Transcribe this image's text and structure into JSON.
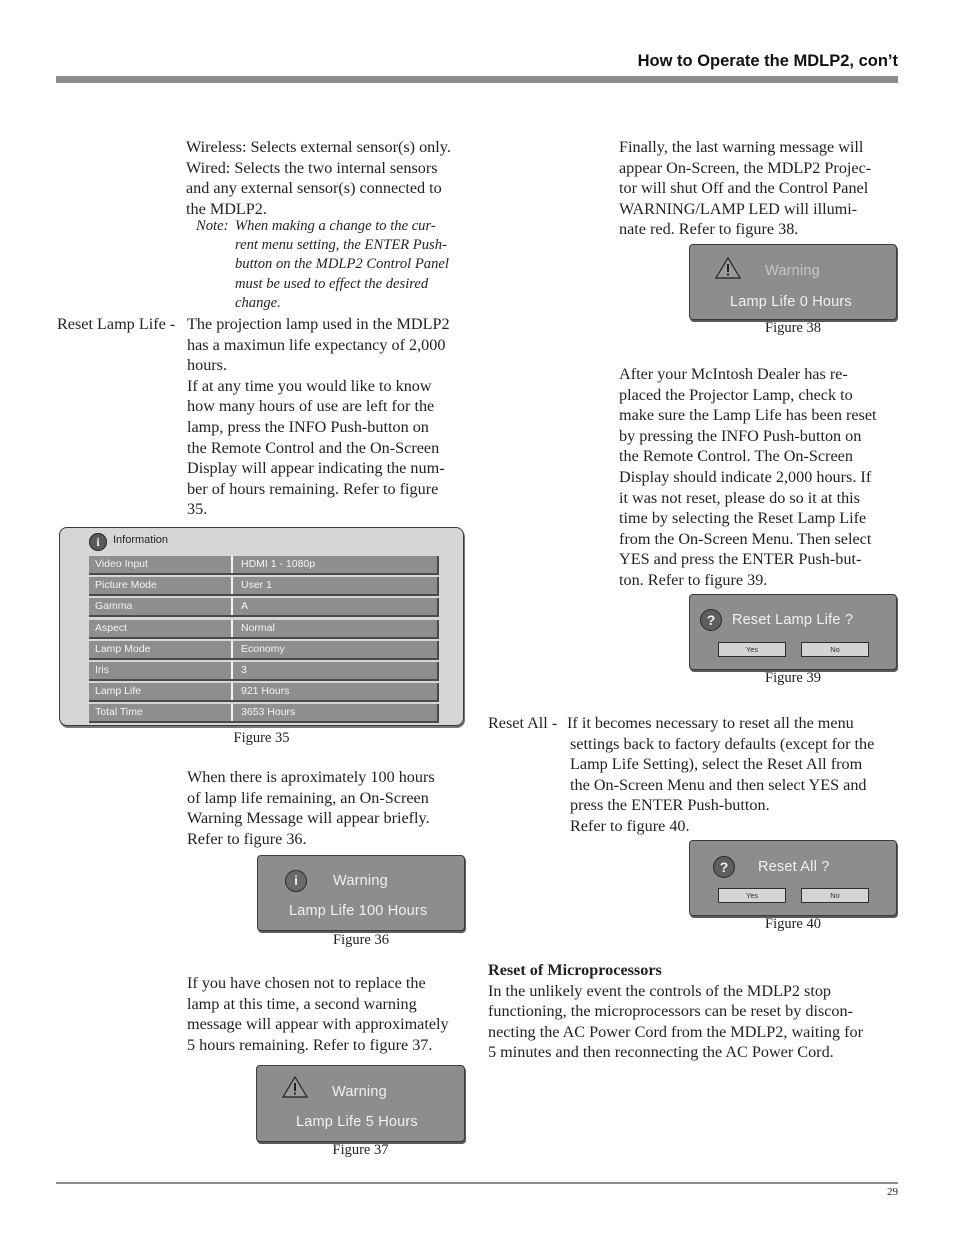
{
  "header": {
    "title": "How to Operate the MDLP2, con’t"
  },
  "left_column": {
    "intro_lines": [
      "Wireless: Selects external sensor(s) only.",
      "Wired: Selects the two internal sensors",
      "and any external sensor(s) connected to",
      "the MDLP2."
    ],
    "note": {
      "label": "Note:",
      "lines": [
        "When making a change to the cur-",
        "rent menu setting, the ENTER Push-",
        "button on the MDLP2 Control Panel",
        "must be used to effect the desired",
        "change."
      ]
    },
    "reset_lamp_life": {
      "term": "Reset Lamp Life -",
      "lines": [
        "The projection lamp used in the MDLP2",
        "has a maximun life expectancy of 2,000",
        "hours.",
        "If at any time you would like to know",
        "how many hours of use are left for the",
        "lamp, press the INFO Push-button on",
        "the Remote Control and the On-Screen",
        "Display will appear indicating the num-",
        "ber of hours remaining. Refer to figure",
        "35."
      ]
    },
    "figure35": {
      "title": "Information",
      "icon": "info-icon",
      "rows": [
        {
          "label": "Video Input",
          "value": "HDMI 1 - 1080p"
        },
        {
          "label": "Picture Mode",
          "value": "User 1"
        },
        {
          "label": "Gamma",
          "value": "A"
        },
        {
          "label": "Aspect",
          "value": "Normal"
        },
        {
          "label": "Lamp Mode",
          "value": "Economy"
        },
        {
          "label": "Iris",
          "value": "3"
        },
        {
          "label": "Lamp Life",
          "value": "921 Hours"
        },
        {
          "label": "Total Time",
          "value": "3653 Hours"
        }
      ],
      "caption": "Figure 35"
    },
    "para_100": [
      "When there is aproximately 100 hours",
      "of lamp life remaining, an On-Screen",
      "Warning Message will appear briefly.",
      "Refer to figure 36."
    ],
    "figure36": {
      "icon": "info-icon",
      "title": "Warning",
      "message": "Lamp Life 100 Hours",
      "caption": "Figure 36"
    },
    "para_5": [
      "If you have chosen not to replace the",
      "lamp at this time, a second warning",
      "message will appear with approximately",
      "5 hours remaining. Refer to figure 37."
    ],
    "figure37": {
      "icon": "warning-triangle-icon",
      "title": "Warning",
      "message": "Lamp Life 5 Hours",
      "caption": "Figure 37"
    }
  },
  "right_column": {
    "para_final": [
      "Finally, the last warning message will",
      "appear On-Screen, the MDLP2 Projec-",
      "tor will shut Off and the Control Panel",
      "WARNING/LAMP LED will illumi-",
      "nate red. Refer to figure 38."
    ],
    "figure38": {
      "icon": "warning-triangle-icon",
      "title": "Warning",
      "message": "Lamp Life 0 Hours",
      "caption": "Figure 38"
    },
    "para_after": [
      "After your McIntosh Dealer has re-",
      "placed the Projector Lamp, check to",
      "make sure the Lamp Life has been reset",
      "by pressing the INFO Push-button on",
      "the Remote Control. The On-Screen",
      "Display should indicate 2,000 hours. If",
      "it was not reset, please do so it at this",
      "time by selecting the Reset Lamp Life",
      "from the On-Screen Menu. Then select",
      "YES and press the ENTER Push-but-",
      "ton. Refer to figure 39."
    ],
    "figure39": {
      "icon": "question-icon",
      "title": "Reset Lamp Life ?",
      "yes": "Yes",
      "no": "No",
      "caption": "Figure 39"
    },
    "reset_all": {
      "term": "Reset All -",
      "first": "If it becomes necessary to reset all the menu",
      "lines": [
        "settings back to factory defaults (except for the",
        "Lamp Life Setting), select the Reset All from",
        "the On-Screen Menu and then select YES and",
        "press the ENTER Push-button.",
        "Refer to figure 40."
      ]
    },
    "figure40": {
      "icon": "question-icon",
      "title": "Reset All ?",
      "yes": "Yes",
      "no": "No",
      "caption": "Figure 40"
    },
    "micro": {
      "heading": "Reset of Microprocessors",
      "lines": [
        "In the unlikely event the controls of the MDLP2 stop",
        "functioning, the microprocessors can be reset by discon-",
        "necting the AC Power Cord from the MDLP2, waiting for",
        "5 minutes and then reconnecting the AC Power Cord."
      ]
    }
  },
  "footer": {
    "page_number": "29"
  }
}
